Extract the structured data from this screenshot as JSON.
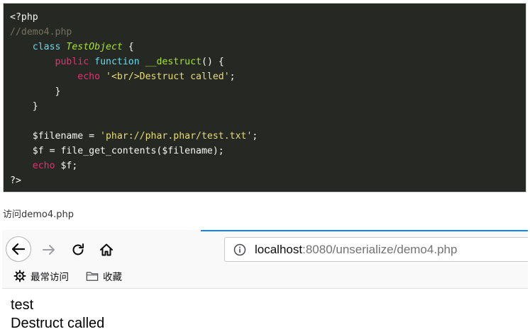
{
  "code_block": {
    "lines": [
      [
        {
          "t": "<?php",
          "c": "plain"
        }
      ],
      [
        {
          "t": "//demo4.php",
          "c": "cmt"
        }
      ],
      [
        {
          "t": "    ",
          "c": "plain"
        },
        {
          "t": "class",
          "c": "kw-blue"
        },
        {
          "t": " ",
          "c": "plain"
        },
        {
          "t": "TestObject",
          "c": "cls"
        },
        {
          "t": " {",
          "c": "plain"
        }
      ],
      [
        {
          "t": "        ",
          "c": "plain"
        },
        {
          "t": "public",
          "c": "kw-pink"
        },
        {
          "t": " ",
          "c": "plain"
        },
        {
          "t": "function",
          "c": "kw-blue"
        },
        {
          "t": " ",
          "c": "plain"
        },
        {
          "t": "__destruct",
          "c": "fn"
        },
        {
          "t": "() {",
          "c": "plain"
        }
      ],
      [
        {
          "t": "            ",
          "c": "plain"
        },
        {
          "t": "echo",
          "c": "kw-pink"
        },
        {
          "t": " ",
          "c": "plain"
        },
        {
          "t": "'<br/>Destruct called'",
          "c": "str"
        },
        {
          "t": ";",
          "c": "plain"
        }
      ],
      [
        {
          "t": "        }",
          "c": "plain"
        }
      ],
      [
        {
          "t": "    }",
          "c": "plain"
        }
      ],
      [
        {
          "t": "",
          "c": "plain"
        }
      ],
      [
        {
          "t": "    $filename = ",
          "c": "plain"
        },
        {
          "t": "'phar://phar.phar/test.txt'",
          "c": "str"
        },
        {
          "t": ";",
          "c": "plain"
        }
      ],
      [
        {
          "t": "    $f = file_get_contents($filename);",
          "c": "plain"
        }
      ],
      [
        {
          "t": "    ",
          "c": "plain"
        },
        {
          "t": "echo",
          "c": "kw-pink"
        },
        {
          "t": " $f;",
          "c": "plain"
        }
      ],
      [
        {
          "t": "?>",
          "c": "plain"
        }
      ]
    ]
  },
  "caption": "访问demo4.php",
  "browser": {
    "url_host": "localhost",
    "url_rest": ":8080/unserialize/demo4.php",
    "bookmarks": [
      {
        "icon": "gear-icon",
        "label": "最常访问"
      },
      {
        "icon": "folder-icon",
        "label": "收藏"
      }
    ],
    "page_output": [
      "test",
      "Destruct called"
    ]
  },
  "colors": {
    "code_background": "#262923",
    "keyword_blue": "#66d9ef",
    "keyword_pink": "#f92672",
    "class_green": "#a6e22e",
    "string_yellow": "#e6db74",
    "comment_gray": "#75715e",
    "load_bar_blue": "#0a84ff"
  }
}
